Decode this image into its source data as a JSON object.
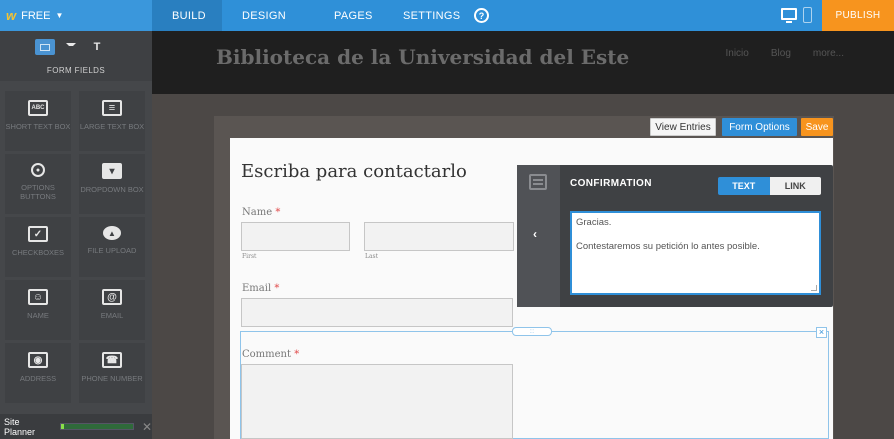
{
  "topbar": {
    "plan_label": "FREE",
    "tabs": [
      {
        "label": "BUILD"
      },
      {
        "label": "DESIGN"
      },
      {
        "label": "PAGES"
      },
      {
        "label": "SETTINGS"
      }
    ],
    "help_glyph": "?",
    "publish_label": "PUBLISH",
    "brand_color": "#2f90d8",
    "publish_color": "#f7941e"
  },
  "sidebar": {
    "section_label": "FORM FIELDS",
    "tab_icons": [
      "grid-icon",
      "columns-icon",
      "text-icon"
    ],
    "text_tab_glyph": "T",
    "fields": [
      {
        "label": "SHORT TEXT BOX",
        "icon": "short-text-icon",
        "glyph": "ABC"
      },
      {
        "label": "LARGE TEXT BOX",
        "icon": "large-text-icon",
        "glyph": "≡"
      },
      {
        "label": "OPTIONS BUTTONS",
        "icon": "radio-icon",
        "glyph": "●"
      },
      {
        "label": "DROPDOWN BOX",
        "icon": "dropdown-icon",
        "glyph": "▾"
      },
      {
        "label": "CHECKBOXES",
        "icon": "checkbox-icon",
        "glyph": "✓"
      },
      {
        "label": "FILE UPLOAD",
        "icon": "upload-cloud-icon",
        "glyph": "▲"
      },
      {
        "label": "NAME",
        "icon": "name-card-icon",
        "glyph": "☺"
      },
      {
        "label": "EMAIL",
        "icon": "email-icon",
        "glyph": "@"
      },
      {
        "label": "ADDRESS",
        "icon": "map-pin-icon",
        "glyph": "◉"
      },
      {
        "label": "PHONE NUMBER",
        "icon": "phone-icon",
        "glyph": "☎"
      }
    ],
    "planner_label": "Site Planner",
    "planner_progress": 0.04,
    "planner_close": "✕"
  },
  "site": {
    "title": "Biblioteca de la Universidad del Este",
    "nav": [
      "Inicio",
      "Blog",
      "more..."
    ]
  },
  "toolbar": {
    "view_entries": "View Entries",
    "form_options": "Form Options",
    "save": "Save"
  },
  "form": {
    "title": "Escriba para contactarlo",
    "required_mark": "*",
    "name_label": "Name",
    "first_sub": "First",
    "last_sub": "Last",
    "email_label": "Email",
    "comment_label": "Comment",
    "handle_glyph": ":::",
    "close_glyph": "×"
  },
  "confirmation": {
    "title": "CONFIRMATION",
    "back_glyph": "‹",
    "toggle_text": "TEXT",
    "toggle_link": "LINK",
    "message_line1": "Gracias.",
    "message_line2": "Contestaremos su petición lo antes posible."
  }
}
